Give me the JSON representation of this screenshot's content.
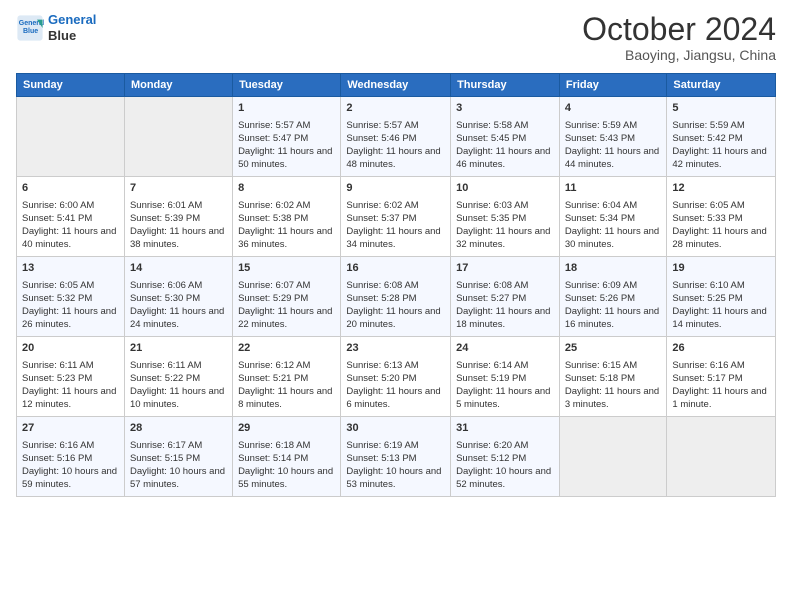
{
  "header": {
    "logo_line1": "General",
    "logo_line2": "Blue",
    "month_title": "October 2024",
    "subtitle": "Baoying, Jiangsu, China"
  },
  "weekdays": [
    "Sunday",
    "Monday",
    "Tuesday",
    "Wednesday",
    "Thursday",
    "Friday",
    "Saturday"
  ],
  "weeks": [
    [
      {
        "day": "",
        "content": ""
      },
      {
        "day": "",
        "content": ""
      },
      {
        "day": "1",
        "content": "Sunrise: 5:57 AM\nSunset: 5:47 PM\nDaylight: 11 hours and 50 minutes."
      },
      {
        "day": "2",
        "content": "Sunrise: 5:57 AM\nSunset: 5:46 PM\nDaylight: 11 hours and 48 minutes."
      },
      {
        "day": "3",
        "content": "Sunrise: 5:58 AM\nSunset: 5:45 PM\nDaylight: 11 hours and 46 minutes."
      },
      {
        "day": "4",
        "content": "Sunrise: 5:59 AM\nSunset: 5:43 PM\nDaylight: 11 hours and 44 minutes."
      },
      {
        "day": "5",
        "content": "Sunrise: 5:59 AM\nSunset: 5:42 PM\nDaylight: 11 hours and 42 minutes."
      }
    ],
    [
      {
        "day": "6",
        "content": "Sunrise: 6:00 AM\nSunset: 5:41 PM\nDaylight: 11 hours and 40 minutes."
      },
      {
        "day": "7",
        "content": "Sunrise: 6:01 AM\nSunset: 5:39 PM\nDaylight: 11 hours and 38 minutes."
      },
      {
        "day": "8",
        "content": "Sunrise: 6:02 AM\nSunset: 5:38 PM\nDaylight: 11 hours and 36 minutes."
      },
      {
        "day": "9",
        "content": "Sunrise: 6:02 AM\nSunset: 5:37 PM\nDaylight: 11 hours and 34 minutes."
      },
      {
        "day": "10",
        "content": "Sunrise: 6:03 AM\nSunset: 5:35 PM\nDaylight: 11 hours and 32 minutes."
      },
      {
        "day": "11",
        "content": "Sunrise: 6:04 AM\nSunset: 5:34 PM\nDaylight: 11 hours and 30 minutes."
      },
      {
        "day": "12",
        "content": "Sunrise: 6:05 AM\nSunset: 5:33 PM\nDaylight: 11 hours and 28 minutes."
      }
    ],
    [
      {
        "day": "13",
        "content": "Sunrise: 6:05 AM\nSunset: 5:32 PM\nDaylight: 11 hours and 26 minutes."
      },
      {
        "day": "14",
        "content": "Sunrise: 6:06 AM\nSunset: 5:30 PM\nDaylight: 11 hours and 24 minutes."
      },
      {
        "day": "15",
        "content": "Sunrise: 6:07 AM\nSunset: 5:29 PM\nDaylight: 11 hours and 22 minutes."
      },
      {
        "day": "16",
        "content": "Sunrise: 6:08 AM\nSunset: 5:28 PM\nDaylight: 11 hours and 20 minutes."
      },
      {
        "day": "17",
        "content": "Sunrise: 6:08 AM\nSunset: 5:27 PM\nDaylight: 11 hours and 18 minutes."
      },
      {
        "day": "18",
        "content": "Sunrise: 6:09 AM\nSunset: 5:26 PM\nDaylight: 11 hours and 16 minutes."
      },
      {
        "day": "19",
        "content": "Sunrise: 6:10 AM\nSunset: 5:25 PM\nDaylight: 11 hours and 14 minutes."
      }
    ],
    [
      {
        "day": "20",
        "content": "Sunrise: 6:11 AM\nSunset: 5:23 PM\nDaylight: 11 hours and 12 minutes."
      },
      {
        "day": "21",
        "content": "Sunrise: 6:11 AM\nSunset: 5:22 PM\nDaylight: 11 hours and 10 minutes."
      },
      {
        "day": "22",
        "content": "Sunrise: 6:12 AM\nSunset: 5:21 PM\nDaylight: 11 hours and 8 minutes."
      },
      {
        "day": "23",
        "content": "Sunrise: 6:13 AM\nSunset: 5:20 PM\nDaylight: 11 hours and 6 minutes."
      },
      {
        "day": "24",
        "content": "Sunrise: 6:14 AM\nSunset: 5:19 PM\nDaylight: 11 hours and 5 minutes."
      },
      {
        "day": "25",
        "content": "Sunrise: 6:15 AM\nSunset: 5:18 PM\nDaylight: 11 hours and 3 minutes."
      },
      {
        "day": "26",
        "content": "Sunrise: 6:16 AM\nSunset: 5:17 PM\nDaylight: 11 hours and 1 minute."
      }
    ],
    [
      {
        "day": "27",
        "content": "Sunrise: 6:16 AM\nSunset: 5:16 PM\nDaylight: 10 hours and 59 minutes."
      },
      {
        "day": "28",
        "content": "Sunrise: 6:17 AM\nSunset: 5:15 PM\nDaylight: 10 hours and 57 minutes."
      },
      {
        "day": "29",
        "content": "Sunrise: 6:18 AM\nSunset: 5:14 PM\nDaylight: 10 hours and 55 minutes."
      },
      {
        "day": "30",
        "content": "Sunrise: 6:19 AM\nSunset: 5:13 PM\nDaylight: 10 hours and 53 minutes."
      },
      {
        "day": "31",
        "content": "Sunrise: 6:20 AM\nSunset: 5:12 PM\nDaylight: 10 hours and 52 minutes."
      },
      {
        "day": "",
        "content": ""
      },
      {
        "day": "",
        "content": ""
      }
    ]
  ]
}
